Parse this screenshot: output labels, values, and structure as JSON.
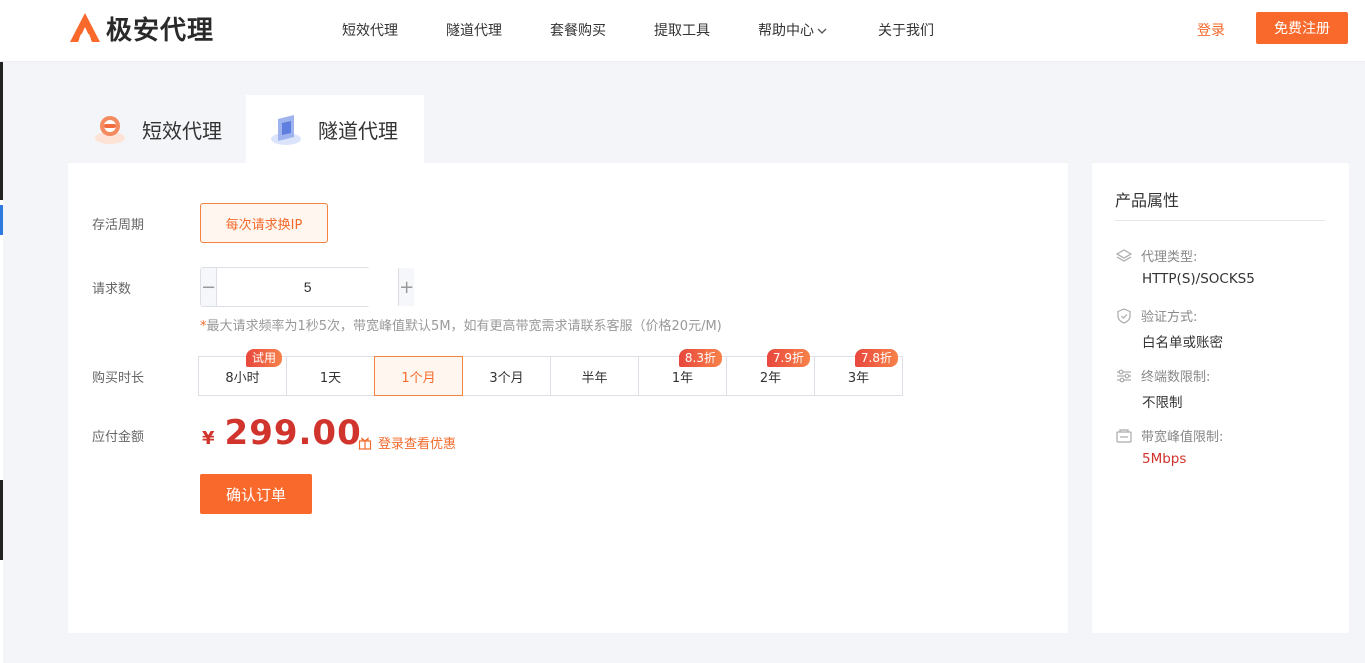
{
  "header": {
    "logo_text": "极安代理",
    "nav": [
      {
        "label": "短效代理"
      },
      {
        "label": "隧道代理"
      },
      {
        "label": "套餐购买"
      },
      {
        "label": "提取工具"
      },
      {
        "label": "帮助中心"
      },
      {
        "label": "关于我们"
      }
    ],
    "login_label": "登录",
    "register_label": "免费注册"
  },
  "tabs": [
    {
      "label": "短效代理",
      "active": false
    },
    {
      "label": "隧道代理",
      "active": true
    }
  ],
  "form": {
    "cycle_label": "存活周期",
    "cycle_value": "每次请求换IP",
    "requests_label": "请求数",
    "requests_value": "5",
    "hint_star": "*",
    "hint_text": "最大请求频率为1秒5次，带宽峰值默认5M，如有更高带宽需求请联系客服（价格20元/M)",
    "duration_label": "购买时长",
    "durations": [
      {
        "label": "8小时",
        "badge": "试用"
      },
      {
        "label": "1天",
        "badge": ""
      },
      {
        "label": "1个月",
        "badge": ""
      },
      {
        "label": "3个月",
        "badge": ""
      },
      {
        "label": "半年",
        "badge": ""
      },
      {
        "label": "1年",
        "badge": "8.3折"
      },
      {
        "label": "2年",
        "badge": "7.9折"
      },
      {
        "label": "3年",
        "badge": "7.8折"
      }
    ],
    "selected_duration": "1个月",
    "amount_label": "应付金额",
    "currency": "¥",
    "amount": "299.00",
    "promo_text": "登录查看优惠",
    "confirm_label": "确认订单"
  },
  "properties": {
    "title": "产品属性",
    "items": [
      {
        "label": "代理类型:",
        "value": "HTTP(S)/SOCKS5",
        "icon": "layers-icon"
      },
      {
        "label": "验证方式:",
        "value": "白名单或账密",
        "icon": "shield-icon"
      },
      {
        "label": "终端数限制:",
        "value": "不限制",
        "icon": "sliders-icon"
      },
      {
        "label": "带宽峰值限制:",
        "value": "5Mbps",
        "icon": "bandwidth-icon"
      }
    ]
  },
  "colors": {
    "accent": "#f8692b",
    "price": "#d0342c",
    "selected_bg": "#fff6ef"
  }
}
